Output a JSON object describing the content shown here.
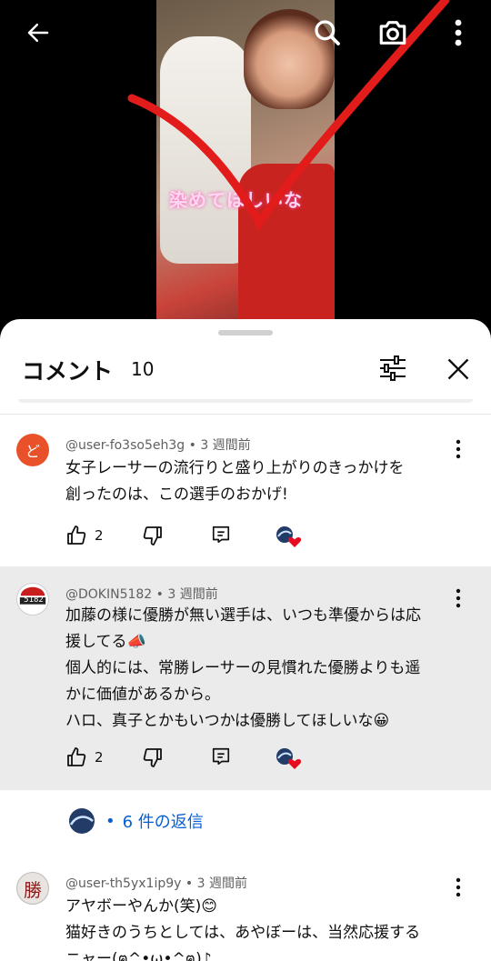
{
  "video": {
    "caption_overlay": "染めてほしいな"
  },
  "comments_panel": {
    "title": "コメント",
    "count": "10"
  },
  "comments": [
    {
      "author": "@user-fo3so5eh3g",
      "time": "3 週間前",
      "avatar_letter": "ど",
      "avatar_color": "#e8512a",
      "lines": [
        "女子レーサーの流行りと盛り上がりのきっかけを",
        "創ったのは、この選手のおかげ!"
      ],
      "likes": "2"
    },
    {
      "author": "@DOKIN5182",
      "time": "3 週間前",
      "avatar_label": "5182",
      "lines": [
        "加藤の様に優勝が無い選手は、いつも準優からは応",
        "援してる📣",
        "個人的には、常勝レーサーの見慣れた優勝よりも遥",
        "かに価値があるから。",
        "ハロ、真子とかもいつかは優勝してほしいな😀"
      ],
      "likes": "2",
      "replies_label": "6 件の返信"
    },
    {
      "author": "@user-th5yx1ip9y",
      "time": "3 週間前",
      "avatar_label": "勝",
      "lines": [
        "アヤボーやんか(笑)😊",
        "猫好きのうちとしては、あやぼーは、当然応援する",
        "ニャー(ฅ^•ω•^ฅ)♪"
      ]
    }
  ],
  "colors": {
    "accent_link": "#065fd4",
    "highlight_bg": "#ebebeb"
  }
}
